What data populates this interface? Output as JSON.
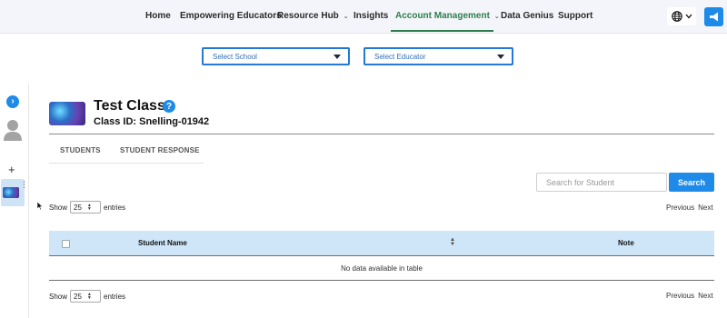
{
  "nav": {
    "items": [
      {
        "label": "Home",
        "has_dropdown": false
      },
      {
        "label": "Empowering Educators",
        "has_dropdown": false
      },
      {
        "label": "Resource Hub",
        "has_dropdown": true
      },
      {
        "label": "Insights",
        "has_dropdown": false
      },
      {
        "label": "Account Management",
        "has_dropdown": true,
        "active": true
      },
      {
        "label": "Data Genius",
        "has_dropdown": false
      },
      {
        "label": "Support",
        "has_dropdown": false
      }
    ],
    "dropdown_chevron": "⌄",
    "language_icon": "globe-icon",
    "announcement_icon": "megaphone-icon",
    "active_color": "#2e7d4f"
  },
  "filters": {
    "school": "Select School",
    "educator": "Select Educator"
  },
  "rail": {
    "expand_symbol": "›",
    "add_symbol": "+",
    "menu_symbol": "⋮"
  },
  "class": {
    "title": "Test Class",
    "help_symbol": "?",
    "id_label": "Class ID: Snelling-01942"
  },
  "tabs": [
    {
      "label": "STUDENTS"
    },
    {
      "label": "STUDENT RESPONSE"
    }
  ],
  "search": {
    "placeholder": "Search for Student",
    "button": "Search"
  },
  "entries": {
    "show": "Show",
    "value": "25",
    "suffix": "entries"
  },
  "pager": {
    "previous": "Previous",
    "next": "Next"
  },
  "table": {
    "columns": [
      "Student Name",
      "Note"
    ],
    "empty": "No data available in table"
  },
  "colors": {
    "primary": "#1e8be8",
    "header_bg": "#cfe6f9"
  }
}
